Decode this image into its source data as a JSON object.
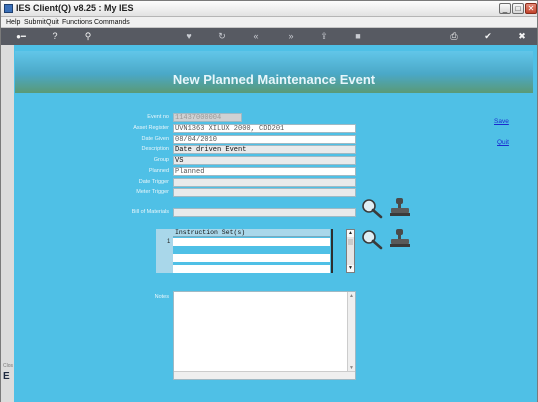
{
  "window": {
    "title": "IES Client(Q) v8.25 : My IES",
    "minimize_glyph": "_",
    "maximize_glyph": "□",
    "close_glyph": "✕"
  },
  "menu": {
    "items": [
      "Help",
      "Submit",
      "Quit",
      "Functions",
      "Commands"
    ]
  },
  "toolbar": {
    "icons": [
      "key-icon",
      "help-icon",
      "search-icon",
      "heart-icon",
      "refresh-icon",
      "rewind-icon",
      "fast-forward-icon",
      "upload-icon",
      "stop-icon",
      "printer-icon",
      "ok-icon",
      "close-icon"
    ],
    "glyphs": {
      "key": "●━",
      "help": "?",
      "search": "⚲",
      "heart": "♥",
      "refresh": "↻",
      "rewind": "«",
      "forward": "»",
      "upload": "⇪",
      "stop": "■",
      "print": "⎙",
      "ok": "✔",
      "close": "✖"
    }
  },
  "page": {
    "title": "New Planned Maintenance Event"
  },
  "actions": {
    "save_label": "Save",
    "quit_label": "Quit"
  },
  "form": {
    "fields": [
      {
        "label": "Event no",
        "value": "11437000004"
      },
      {
        "label": "Asset Register",
        "value": "UVN1363 XILUX 2000, CDD201"
      },
      {
        "label": "Date Given",
        "value": "08/04/2010"
      },
      {
        "label": "Description",
        "value": "Date driven Event"
      },
      {
        "label": "Group",
        "value": "VS"
      },
      {
        "label": "Planned",
        "value": "Planned"
      },
      {
        "label": "Date Trigger",
        "value": ""
      },
      {
        "label": "Meter Trigger",
        "value": ""
      },
      {
        "label": "Bill of Materials",
        "value": ""
      },
      {
        "label": "Notes",
        "value": ""
      }
    ]
  },
  "instructions_grid": {
    "header": "Instruction Set(s)",
    "row_number": "1",
    "scroll_up": "▲",
    "scroll_down": "▼"
  },
  "left_strip": {
    "mark": "E",
    "tiny": "Clos"
  },
  "colors": {
    "content_bg": "#4fc0e6",
    "toolbar_bg": "#575a62",
    "link": "#1b2bd0"
  }
}
